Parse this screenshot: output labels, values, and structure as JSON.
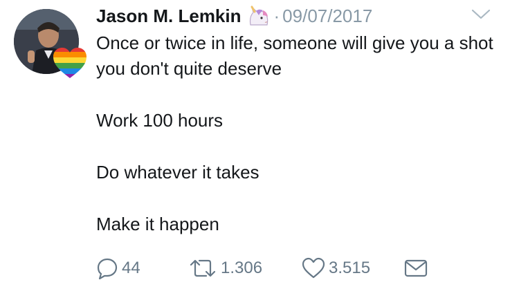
{
  "tweet": {
    "author_name": "Jason M. Lemkin",
    "author_emoji": "unicorn-emoji",
    "separator": "·",
    "date": "09/07/2017",
    "lines": [
      "Once or twice in life, someone will give you a shot you don't quite deserve",
      "Work 100 hours",
      "Do whatever it takes",
      "Make it happen"
    ],
    "actions": {
      "replies": "44",
      "retweets": "1.306",
      "likes": "3.515"
    }
  },
  "icons": {
    "reply": "reply-icon",
    "retweet": "retweet-icon",
    "like": "heart-icon",
    "dm": "envelope-icon",
    "caret": "chevron-down-icon"
  },
  "colors": {
    "text": "#14171a",
    "muted": "#8899a6",
    "action": "#657786"
  }
}
